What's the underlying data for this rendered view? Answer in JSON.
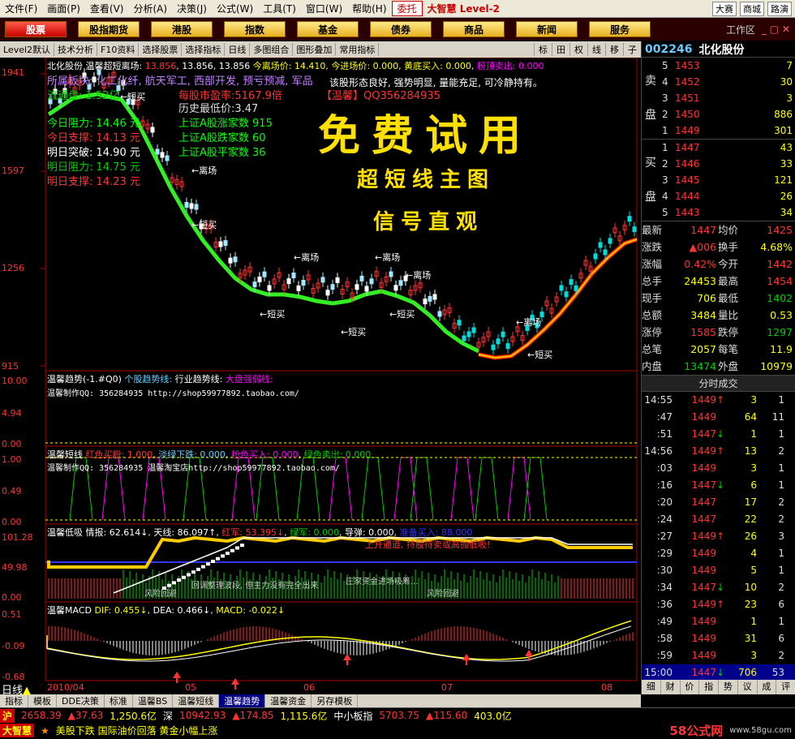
{
  "menubar": {
    "items": [
      "文件(F)",
      "画面(P)",
      "查看(V)",
      "分析(A)",
      "决策(J)",
      "公式(W)",
      "工具(T)",
      "窗口(W)",
      "帮助(H)"
    ],
    "badge": "委托",
    "brand": "大智慧 Level-2",
    "right_buttons": [
      "大赛",
      "商城",
      "路演"
    ]
  },
  "navbar": {
    "items": [
      "股票",
      "股指期货",
      "港股",
      "指数",
      "基金",
      "债券",
      "商品",
      "新闻",
      "服务"
    ],
    "active": "股票",
    "workarea": "工作区"
  },
  "toolbar": {
    "items": [
      "Level2默认",
      "技术分析",
      "F10资料",
      "选择股票",
      "选择指标",
      "日线",
      "多图组合",
      "图形叠加",
      "常用指标"
    ],
    "right": [
      "标",
      "田",
      "权",
      "线",
      "移",
      "子"
    ]
  },
  "main_chart": {
    "header": {
      "name": "北化股份",
      "indicator": "温馨超短离场:",
      "v1": "13.856",
      "v2": "13.856",
      "v3": "13.856",
      "today_exit": "今离场价: 14.410",
      "today_entry": "今进场价: 0.000",
      "bottom_buy": "黄底买入: 0.000",
      "pink_top": "粉顶卖出: 0.000"
    },
    "info_lines": {
      "sector": "所属板块: 化工化纤, 航天军工, 西部开发, 预亏预减, 军品",
      "float": "流通盘: 1.52亿",
      "pe": "每股市盈率:5167.9倍",
      "tag": "【温馨】QQ356284935",
      "hist_low": "历史最低价:3.47",
      "resist_today": "今日阻力: 14.46 元",
      "support_today": "今日支撑: 14.13 元",
      "break_tom": "明日突破: 14.90 元",
      "resist_tom": "明日阻力: 14.75 元",
      "support_tom": "明日支撑: 14.23 元",
      "up_count": "上证A股涨家数   915",
      "down_count": "上证A股跌家数   60",
      "flat_count": "上证A股平家数   36",
      "comment": "该股形态良好, 强势明显, 量能充足, 可冷静持有。"
    },
    "promo": {
      "big": "免费试用",
      "line2": "超短线主图",
      "line3": "信号直观"
    },
    "y_labels": [
      "1941",
      "1597",
      "1256",
      "915"
    ],
    "signal_labels": {
      "exit": "离场",
      "short_buy": "短买"
    }
  },
  "panels": {
    "trend": {
      "title": "温馨趋势(-1.#Q0)",
      "t2": "个股趋势线:",
      "t3": "行业趋势线:",
      "t4": "大盘强弱线:",
      "credit": "温馨制作QQ: 356284935 http://shop59977892.taobao.com/",
      "y_labels": [
        "10.00",
        "4.94",
        "0.00"
      ]
    },
    "short": {
      "title": "温馨短线",
      "t2": "红色买粉: 1.000",
      "t3": "淡绿下跌: 0.000",
      "t4": "粉色买入: 0.000",
      "t5": "绿色卖出: 0.000",
      "credit": "温馨制作QQ: 356284935 温馨淘宝店http://shop59977892.taobao.com/",
      "y_labels": [
        "1.00",
        "0.49",
        "0.00"
      ]
    },
    "lowsuck": {
      "title": "温馨低吸",
      "s1": "情报: 62.614↓",
      "s2": "天线: 86.097↑",
      "s3": "红军: 53.395↓",
      "s4": "绿军: 0.000",
      "s5": "导弹: 0.000",
      "s6": "准备买入: 88.000",
      "note1": "上升通道, 持股待卖或高抛低吸!",
      "note2": "风险回避",
      "note3": "回调整理波段, 但主力没有完全出来",
      "note4": "庄家资金进场吸筹...",
      "note5": "风险回避",
      "y_labels": [
        "101.28",
        "49.98",
        "0.00"
      ]
    },
    "macd": {
      "title": "温馨MACD",
      "dif": "DIF: 0.455↓",
      "dea": "DEA: 0.466↓",
      "macd": "MACD: -0.022↓",
      "y_labels": [
        "0.51",
        "-0.09",
        "-0.68"
      ],
      "x_labels": [
        "2010/04",
        "05",
        "06",
        "07",
        "08"
      ]
    }
  },
  "right_panel": {
    "code": "002246",
    "name": "北化股份",
    "sell_label": "卖盘",
    "buy_label": "买盘",
    "sells": [
      {
        "i": "5",
        "p": "1453",
        "v": "7"
      },
      {
        "i": "4",
        "p": "1452",
        "v": "30"
      },
      {
        "i": "3",
        "p": "1451",
        "v": "3"
      },
      {
        "i": "2",
        "p": "1450",
        "v": "886"
      },
      {
        "i": "1",
        "p": "1449",
        "v": "301"
      }
    ],
    "buys": [
      {
        "i": "1",
        "p": "1447",
        "v": "43"
      },
      {
        "i": "2",
        "p": "1446",
        "v": "33"
      },
      {
        "i": "3",
        "p": "1445",
        "v": "121"
      },
      {
        "i": "4",
        "p": "1444",
        "v": "26"
      },
      {
        "i": "5",
        "p": "1443",
        "v": "34"
      }
    ],
    "quotes": [
      [
        "最新",
        "1447",
        "均价",
        "1425"
      ],
      [
        "涨跌",
        "▲006",
        "换手",
        "4.68%"
      ],
      [
        "涨幅",
        "0.42%",
        "今开",
        "1442"
      ],
      [
        "总手",
        "24453",
        "最高",
        "1454"
      ],
      [
        "现手",
        "706",
        "最低",
        "1402"
      ],
      [
        "总额",
        "3484",
        "量比",
        "0.53"
      ],
      [
        "涨停",
        "1585",
        "跌停",
        "1297"
      ],
      [
        "总笔",
        "2057",
        "每笔",
        "11.9"
      ],
      [
        "内盘",
        "13474",
        "外盘",
        "10979"
      ]
    ],
    "trades_title": "分时成交",
    "trades": [
      {
        "t": "14:55",
        "p": "1449",
        "d": "up",
        "v": "3",
        "n": "1"
      },
      {
        "t": ":47",
        "p": "1449",
        "d": "",
        "v": "64",
        "n": "11"
      },
      {
        "t": ":51",
        "p": "1447",
        "d": "dn",
        "v": "1",
        "n": "1"
      },
      {
        "t": "14:56",
        "p": "1449",
        "d": "up",
        "v": "13",
        "n": "2"
      },
      {
        "t": ":03",
        "p": "1449",
        "d": "",
        "v": "3",
        "n": "1"
      },
      {
        "t": ":16",
        "p": "1447",
        "d": "dn",
        "v": "6",
        "n": "1"
      },
      {
        "t": ":20",
        "p": "1447",
        "d": "",
        "v": "17",
        "n": "2"
      },
      {
        "t": ":24",
        "p": "1447",
        "d": "",
        "v": "22",
        "n": "2"
      },
      {
        "t": ":27",
        "p": "1449",
        "d": "up",
        "v": "26",
        "n": "3"
      },
      {
        "t": ":29",
        "p": "1449",
        "d": "",
        "v": "4",
        "n": "1"
      },
      {
        "t": ":30",
        "p": "1449",
        "d": "",
        "v": "5",
        "n": "1"
      },
      {
        "t": ":34",
        "p": "1447",
        "d": "dn",
        "v": "10",
        "n": "2"
      },
      {
        "t": ":36",
        "p": "1449",
        "d": "up",
        "v": "23",
        "n": "6"
      },
      {
        "t": ":49",
        "p": "1449",
        "d": "",
        "v": "1",
        "n": "1"
      },
      {
        "t": ":58",
        "p": "1449",
        "d": "",
        "v": "31",
        "n": "6"
      },
      {
        "t": ":59",
        "p": "1449",
        "d": "",
        "v": "3",
        "n": "2"
      },
      {
        "t": "15:00",
        "p": "1447",
        "d": "dn",
        "v": "706",
        "n": "53"
      }
    ],
    "tabs": [
      "细",
      "财",
      "价",
      "指",
      "势",
      "议",
      "成",
      "评"
    ]
  },
  "bottom_tabs": [
    "指标",
    "模板",
    "DDE决策",
    "标准",
    "温馨BS",
    "温馨短线",
    "温馨趋势",
    "温馨资金",
    "另存模板"
  ],
  "bottom_active": "温馨趋势",
  "bottom_left": "日线",
  "status": {
    "sh_label": "沪",
    "sh": "2658.39",
    "sh_chg": "▲37.63",
    "sh_amt": "1,250.6亿",
    "sz_label": "深",
    "sz": "10942.93",
    "sz_chg": "▲174.85",
    "sz_amt": "1,115.6亿",
    "zx_label": "中小板指",
    "zx": "5703.75",
    "zx_chg": "▲115.60",
    "zx_amt": "403.0亿"
  },
  "news": {
    "logo": "大智慧",
    "text": "美股下跌 国际油价回落 黄金小幅上涨",
    "watermark": "58公式网",
    "url": "www.58gu.com"
  },
  "colors": {
    "up": "#ff3333",
    "down": "#00cc00",
    "accent": "#ffff00",
    "ma_green": "#33ee22",
    "ma_red": "#ff2200"
  }
}
